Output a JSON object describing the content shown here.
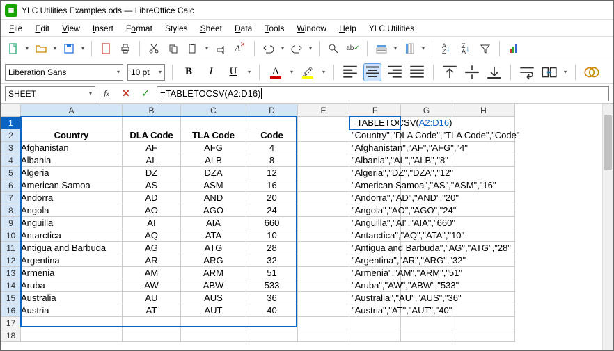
{
  "title": "YLC Utilities Examples.ods — LibreOffice Calc",
  "app_icon_char": "⊞",
  "menu": [
    "File",
    "Edit",
    "View",
    "Insert",
    "Format",
    "Styles",
    "Sheet",
    "Data",
    "Tools",
    "Window",
    "Help",
    "YLC Utilities"
  ],
  "menu_underline_idx": [
    0,
    0,
    0,
    0,
    1,
    6,
    0,
    0,
    0,
    0,
    0,
    -1
  ],
  "font_name": "Liberation Sans",
  "font_size": "10 pt",
  "name_box": "SHEET",
  "formula_text_pre": "=TABLETOCSV(",
  "formula_text_ref": "A2:D16",
  "formula_text_post": ")",
  "formula_plain": "=TABLETOCSV(A2:D16)",
  "columns": [
    "A",
    "B",
    "C",
    "D",
    "E",
    "F",
    "G",
    "H"
  ],
  "row_count": 18,
  "headers": [
    "Country",
    "DLA Code",
    "TLA Code",
    "Code"
  ],
  "table_rows": [
    [
      "Afghanistan",
      "AF",
      "AFG",
      "4"
    ],
    [
      "Albania",
      "AL",
      "ALB",
      "8"
    ],
    [
      "Algeria",
      "DZ",
      "DZA",
      "12"
    ],
    [
      "American Samoa",
      "AS",
      "ASM",
      "16"
    ],
    [
      "Andorra",
      "AD",
      "AND",
      "20"
    ],
    [
      "Angola",
      "AO",
      "AGO",
      "24"
    ],
    [
      "Anguilla",
      "AI",
      "AIA",
      "660"
    ],
    [
      "Antarctica",
      "AQ",
      "ATA",
      "10"
    ],
    [
      "Antigua and Barbuda",
      "AG",
      "ATG",
      "28"
    ],
    [
      "Argentina",
      "AR",
      "ARG",
      "32"
    ],
    [
      "Armenia",
      "AM",
      "ARM",
      "51"
    ],
    [
      "Aruba",
      "AW",
      "ABW",
      "533"
    ],
    [
      "Australia",
      "AU",
      "AUS",
      "36"
    ],
    [
      "Austria",
      "AT",
      "AUT",
      "40"
    ]
  ],
  "f1_pre": "=TABLETOCSV(",
  "f1_ref": "A2:D16",
  "f1_post": ")",
  "csv_lines": [
    "\"Country\",\"DLA Code\",\"TLA Code\",\"Code\"",
    "\"Afghanistan\",\"AF\",\"AFG\",\"4\"",
    "\"Albania\",\"AL\",\"ALB\",\"8\"",
    "\"Algeria\",\"DZ\",\"DZA\",\"12\"",
    "\"American Samoa\",\"AS\",\"ASM\",\"16\"",
    "\"Andorra\",\"AD\",\"AND\",\"20\"",
    "\"Angola\",\"AO\",\"AGO\",\"24\"",
    "\"Anguilla\",\"AI\",\"AIA\",\"660\"",
    "\"Antarctica\",\"AQ\",\"ATA\",\"10\"",
    "\"Antigua and Barbuda\",\"AG\",\"ATG\",\"28\"",
    "\"Argentina\",\"AR\",\"ARG\",\"32\"",
    "\"Armenia\",\"AM\",\"ARM\",\"51\"",
    "\"Aruba\",\"AW\",\"ABW\",\"533\"",
    "\"Australia\",\"AU\",\"AUS\",\"36\"",
    "\"Austria\",\"AT\",\"AUT\",\"40\""
  ],
  "colors": {
    "accent": "#0b63c4",
    "green": "#18a303",
    "red": "#c0392b"
  },
  "chart_data": {
    "type": "table",
    "title": "",
    "columns": [
      "Country",
      "DLA Code",
      "TLA Code",
      "Code"
    ],
    "rows": [
      [
        "Afghanistan",
        "AF",
        "AFG",
        4
      ],
      [
        "Albania",
        "AL",
        "ALB",
        8
      ],
      [
        "Algeria",
        "DZ",
        "DZA",
        12
      ],
      [
        "American Samoa",
        "AS",
        "ASM",
        16
      ],
      [
        "Andorra",
        "AD",
        "AND",
        20
      ],
      [
        "Angola",
        "AO",
        "AGO",
        24
      ],
      [
        "Anguilla",
        "AI",
        "AIA",
        660
      ],
      [
        "Antarctica",
        "AQ",
        "ATA",
        10
      ],
      [
        "Antigua and Barbuda",
        "AG",
        "ATG",
        28
      ],
      [
        "Argentina",
        "AR",
        "ARG",
        32
      ],
      [
        "Armenia",
        "AM",
        "ARM",
        51
      ],
      [
        "Aruba",
        "AW",
        "ABW",
        533
      ],
      [
        "Australia",
        "AU",
        "AUS",
        36
      ],
      [
        "Austria",
        "AT",
        "AUT",
        40
      ]
    ]
  }
}
